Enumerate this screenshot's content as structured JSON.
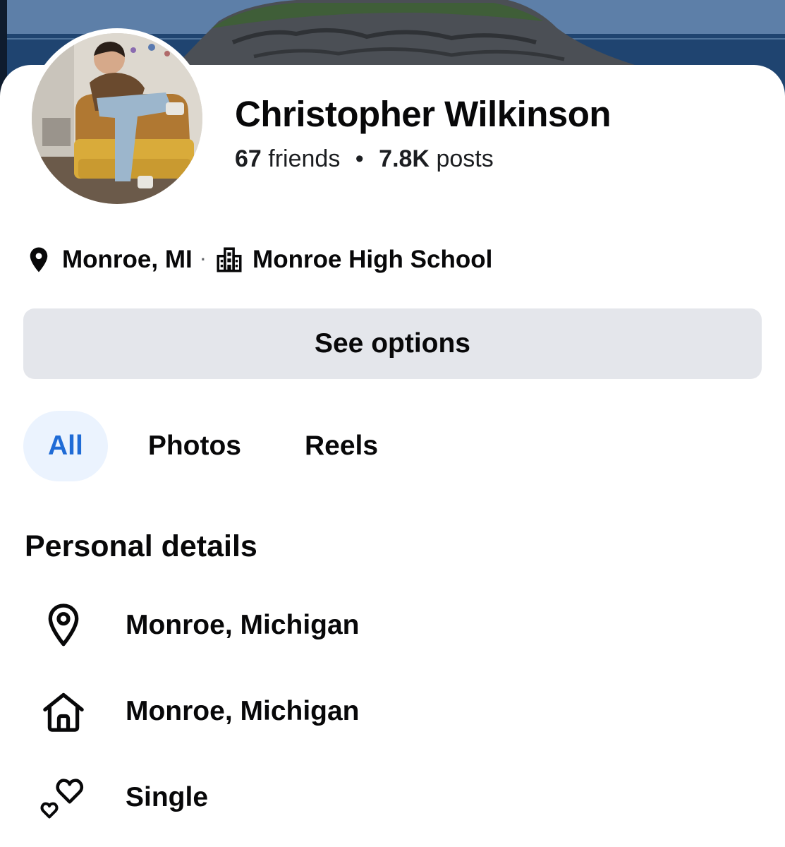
{
  "profile": {
    "name": "Christopher Wilkinson",
    "friends_count": "67",
    "friends_label": "friends",
    "posts_count": "7.8K",
    "posts_label": "posts"
  },
  "intro": {
    "location": "Monroe, MI",
    "separator": "·",
    "school": "Monroe High School"
  },
  "options_button": {
    "label": "See options"
  },
  "tabs": [
    {
      "label": "All",
      "active": true
    },
    {
      "label": "Photos",
      "active": false
    },
    {
      "label": "Reels",
      "active": false
    }
  ],
  "personal_details": {
    "title": "Personal details",
    "items": [
      {
        "icon": "location-pin-icon",
        "text": "Monroe, Michigan"
      },
      {
        "icon": "home-icon",
        "text": "Monroe, Michigan"
      },
      {
        "icon": "hearts-icon",
        "text": "Single"
      }
    ]
  },
  "colors": {
    "active_tab_text": "#1f6bd6",
    "active_tab_bg": "#ebf3fe",
    "button_bg": "#e4e6eb"
  }
}
